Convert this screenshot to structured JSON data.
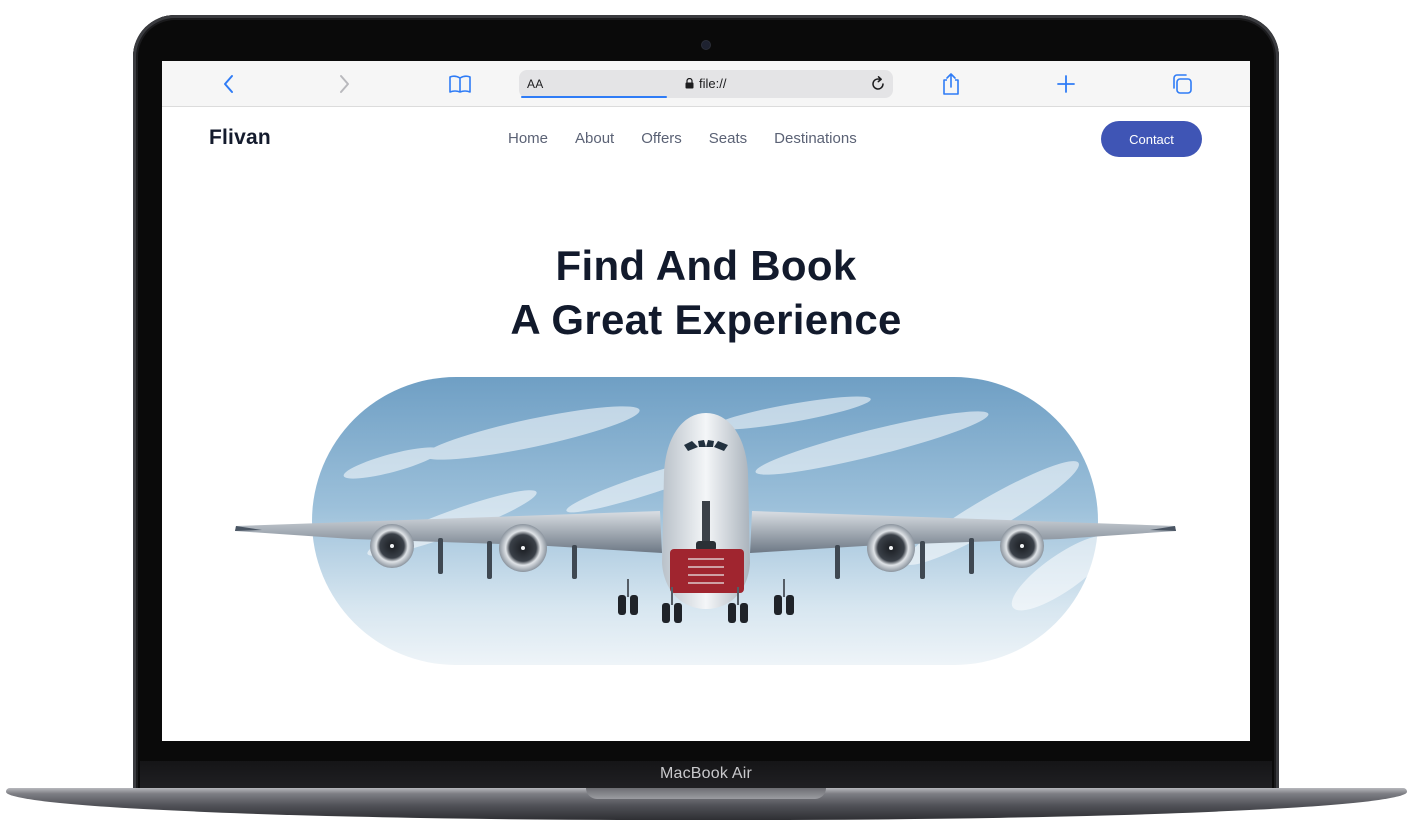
{
  "device": {
    "label": "MacBook Air"
  },
  "browser": {
    "address_bar": {
      "text_size_label": "AA",
      "url": "file://",
      "load_progress": 0.39
    },
    "toolbar_icons": [
      "back-icon",
      "forward-icon",
      "bookmarks-icon",
      "lock-icon",
      "reload-icon",
      "share-icon",
      "new-tab-icon",
      "tabs-icon"
    ],
    "accent_color": "#2f7cf6"
  },
  "site": {
    "brand": "Flivan",
    "nav": [
      "Home",
      "About",
      "Offers",
      "Seats",
      "Destinations"
    ],
    "contact_button": "Contact",
    "hero": {
      "title_line1": "Find And Book",
      "title_line2": "A Great Experience",
      "image": "airplane-hero-image"
    },
    "colors": {
      "primary": "#3f55b5",
      "heading": "#121a2c",
      "nav_text": "#5b6275"
    }
  }
}
